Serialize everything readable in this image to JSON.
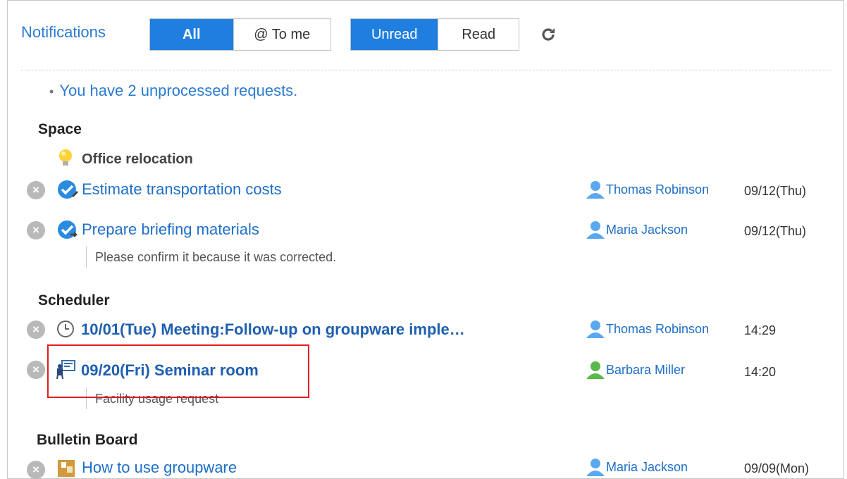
{
  "header": {
    "title": "Notifications",
    "filter_all": "All",
    "filter_to_me": "@ To me",
    "filter_unread": "Unread",
    "filter_read": "Read"
  },
  "requests_notice": "You have 2 unprocessed requests.",
  "sections": {
    "space": {
      "title": "Space",
      "subheading": "Office relocation",
      "items": [
        {
          "title": "Estimate transportation costs",
          "user": "Thomas Robinson",
          "date": "09/12(Thu)"
        },
        {
          "title": "Prepare briefing materials",
          "user": "Maria Jackson",
          "date": "09/12(Thu)",
          "note": "Please confirm it because it was corrected."
        }
      ]
    },
    "scheduler": {
      "title": "Scheduler",
      "items": [
        {
          "title": "10/01(Tue) Meeting:Follow-up on groupware imple…",
          "user": "Thomas Robinson",
          "date": "14:29"
        },
        {
          "title": "09/20(Fri) Seminar room",
          "user": "Barbara Miller",
          "date": "14:20",
          "note": "Facility usage request"
        }
      ]
    },
    "bulletin": {
      "title": "Bulletin Board",
      "items": [
        {
          "title": "How to use groupware",
          "user": "Maria Jackson",
          "date": "09/09(Mon)"
        }
      ]
    }
  },
  "colors": {
    "accent": "#1f7ee0",
    "link": "#1e6fc8",
    "highlight_box": "#e11b22"
  }
}
